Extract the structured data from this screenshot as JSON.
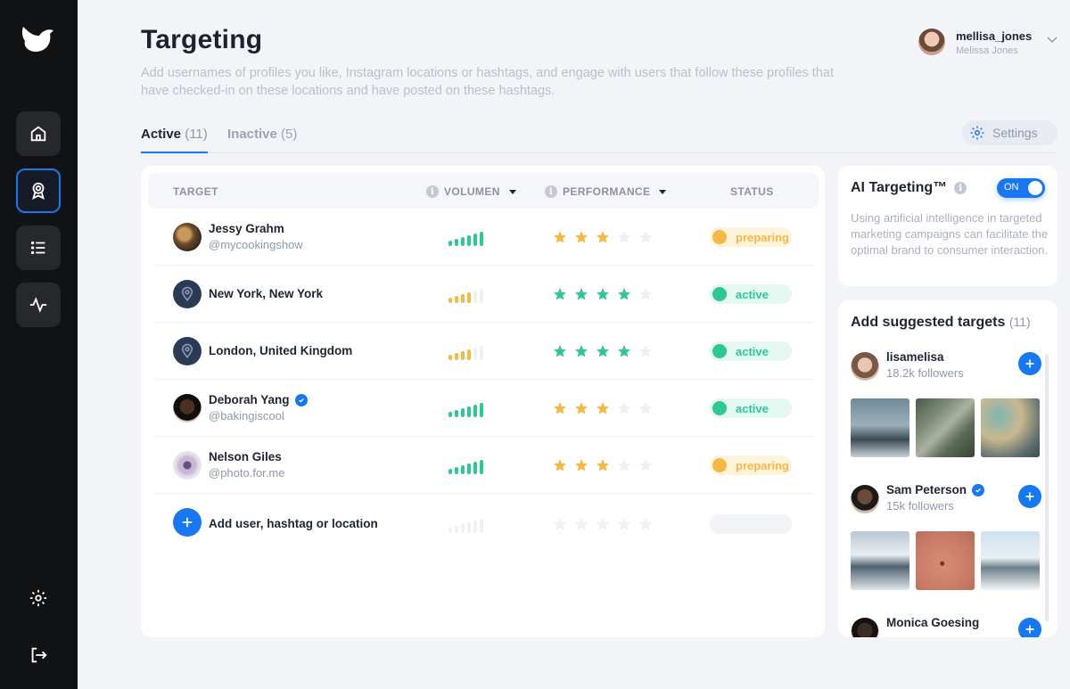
{
  "colors": {
    "accent": "#1877f2",
    "green": "#2dc98f",
    "yellow": "#f7b843",
    "sidebar": "#111214"
  },
  "sidebar": {
    "logo_icon": "bird-logo-icon",
    "items": [
      {
        "name": "home",
        "icon": "home-icon"
      },
      {
        "name": "targeting",
        "icon": "target-badge-icon",
        "active": true
      },
      {
        "name": "list",
        "icon": "list-icon"
      },
      {
        "name": "activity",
        "icon": "pulse-icon"
      }
    ],
    "bottom": [
      {
        "name": "settings",
        "icon": "gear-icon"
      },
      {
        "name": "logout",
        "icon": "logout-icon"
      }
    ]
  },
  "header": {
    "title": "Targeting",
    "description": "Add usernames of profiles you like, Instagram locations or hashtags, and engage with users that follow these profiles that have checked-in on these locations and have posted on these hashtags."
  },
  "user": {
    "handle": "mellisa_jones",
    "name": "Melissa Jones"
  },
  "tabs": [
    {
      "label": "Active",
      "count": "(11)"
    },
    {
      "label": "Inactive",
      "count": "(5)"
    }
  ],
  "settings_label": "Settings",
  "table": {
    "headers": {
      "target": "TARGET",
      "volume": "VOLUMEN",
      "performance": "PERFORMANCE",
      "status": "STATUS"
    },
    "rows": [
      {
        "name": "Jessy Grahm",
        "sub": "@mycookingshow",
        "type": "user",
        "verified": false,
        "volume_level": 6,
        "volume_color": "green",
        "stars": 3,
        "star_color": "yellow",
        "status": "preparing"
      },
      {
        "name": "New York, New York",
        "sub": "",
        "type": "location",
        "verified": false,
        "volume_level": 4,
        "volume_color": "yellow",
        "stars": 4,
        "star_color": "green",
        "status": "active"
      },
      {
        "name": "London, United Kingdom",
        "sub": "",
        "type": "location",
        "verified": false,
        "volume_level": 4,
        "volume_color": "yellow",
        "stars": 4,
        "star_color": "green",
        "status": "active"
      },
      {
        "name": "Deborah Yang",
        "sub": "@bakingiscool",
        "type": "user",
        "verified": true,
        "volume_level": 6,
        "volume_color": "green",
        "stars": 3,
        "star_color": "yellow",
        "status": "active"
      },
      {
        "name": "Nelson Giles",
        "sub": "@photo.for.me",
        "type": "user",
        "verified": false,
        "volume_level": 6,
        "volume_color": "green",
        "stars": 3,
        "star_color": "yellow",
        "status": "preparing"
      }
    ],
    "add_label": "Add user, hashtag or location"
  },
  "ai_targeting": {
    "title": "AI Targeting™",
    "toggle_label": "ON",
    "description": "Using artificial intelligence in targeted marketing campaigns can facilitate the optimal brand to consumer interaction."
  },
  "suggested": {
    "title": "Add suggested targets",
    "count": "(11)",
    "users": [
      {
        "name": "lisamelisa",
        "followers": "18.2k followers",
        "verified": false
      },
      {
        "name": "Sam Peterson",
        "followers": "15k followers",
        "verified": true
      },
      {
        "name": "Monica Goesing",
        "followers": "",
        "verified": false
      }
    ]
  }
}
